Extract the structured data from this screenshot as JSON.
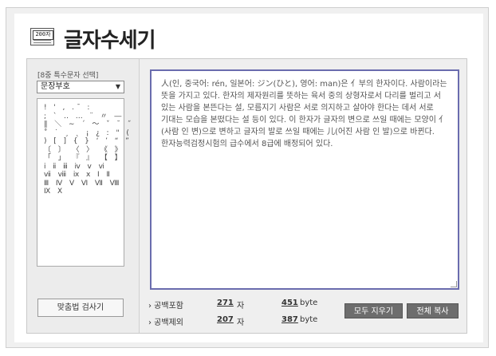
{
  "header": {
    "logo_counter": "200자",
    "title": "글자수세기"
  },
  "sidebar": {
    "label": "[8중 특수문자 선택]",
    "select_value": "문장부호",
    "symbol_rows": [
      "!  '  ,  .  ̄  :",
      ";  `  ‥  …  ¨  〃  ―",
      "∥  ＼  ∼  ´  ～  ˇ  ˘  ˝",
      "˚  ˙  ¸  ˛  ¡  ¿  ː  \"  (",
      ")  [  ]  {  }  ‘  ’  “  ”",
      "〔  〕  〈  〉  《  》",
      "「  」  『  』  【  】",
      "ⅰ  ⅱ  ⅲ  ⅳ  ⅴ  ⅵ",
      "ⅶ  ⅷ  ⅸ  ⅹ  Ⅰ  Ⅱ",
      "Ⅲ  Ⅳ  Ⅴ  Ⅵ  Ⅶ  Ⅷ",
      "Ⅸ  Ⅹ"
    ],
    "spellcheck_label": "맞춤법 검사기"
  },
  "editor": {
    "text": "人(인, 중국어: rén, 일본어: ジン(ひと), 영어: man)은 亻부의 한자이다. 사람이라는 뜻을 가지고 있다. 한자의 제자원리를 뜻하는 육서 중의 상형자로서 다리를 벌리고 서 있는 사람을 본뜬다는 설, 모름지기 사람은 서로 의지하고 살아야 한다는 데서 서로 기대는 모습을 본떴다는 설 등이 있다. 이 한자가 글자의 변으로 쓰일 때에는 모양이 亻(사람 인 변)으로 변하고 글자의 발로 쓰일 때에는 儿(어진 사람 인 발)으로 바뀐다. 한자능력검정시험의 급수에서 8급에 배정되어 있다."
  },
  "stats": {
    "with_spaces": {
      "label": "› 공백포함",
      "chars": "271",
      "chars_unit": "자",
      "bytes": "451",
      "bytes_unit": "byte"
    },
    "without_spaces": {
      "label": "› 공백제외",
      "chars": "207",
      "chars_unit": "자",
      "bytes": "387",
      "bytes_unit": "byte"
    }
  },
  "buttons": {
    "clear_all": "모두 지우기",
    "copy_all": "전체 복사"
  },
  "colors": {
    "editor_border": "#6a6cae",
    "button_dark": "#6d6d6d"
  }
}
